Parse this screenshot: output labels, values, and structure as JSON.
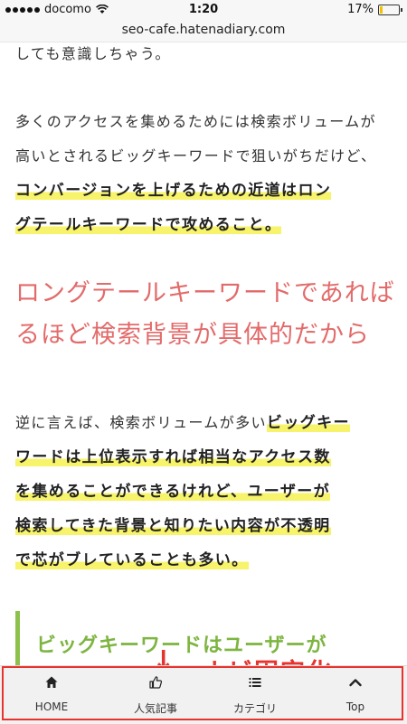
{
  "status_bar": {
    "carrier": "docomo",
    "time": "1:20",
    "battery": "17%",
    "battery_level": 0.17
  },
  "url_bar": {
    "url": "seo-cafe.hatenadiary.com"
  },
  "article": {
    "top_line": "しても意識しちゃう。",
    "para1": {
      "line1": "多くのアクセスを集めるためには検索ボリュームが",
      "line2": "高いとされるビッグキーワードで狙いがちだけど、",
      "line3": "コンバージョンを上げるための近道はロン",
      "line4": "グテールキーワードで攻めること。"
    },
    "heading": {
      "line1": "ロングテールキーワードであれば",
      "line2": "るほど検索背景が具体的だから"
    },
    "para2": {
      "line1_plain": "逆に言えば、検索ボリュームが多い",
      "line1_bold": "ビッグキー",
      "line2": "ワードは上位表示すれば相当なアクセス数",
      "line3": "を集めることができるけれど、ユーザーが",
      "line4": "検索してきた背景と知りたい内容が不透明",
      "line5": "で芯がブレていることも多い。"
    },
    "subheading": "ビッグキーワードはユーザーが"
  },
  "annotation": {
    "arrow": "↓",
    "text": "ナビ固定化"
  },
  "bottom_nav": {
    "items": [
      {
        "label": "HOME",
        "icon": "home-icon"
      },
      {
        "label": "人気記事",
        "icon": "thumbs-up-icon"
      },
      {
        "label": "カテゴリ",
        "icon": "list-icon"
      },
      {
        "label": "Top",
        "icon": "chevron-up-icon"
      }
    ]
  },
  "colors": {
    "heading": "#e36a6a",
    "highlight": "#f7f36a",
    "subheading": "#7db540",
    "annotation": "#e8322d"
  }
}
